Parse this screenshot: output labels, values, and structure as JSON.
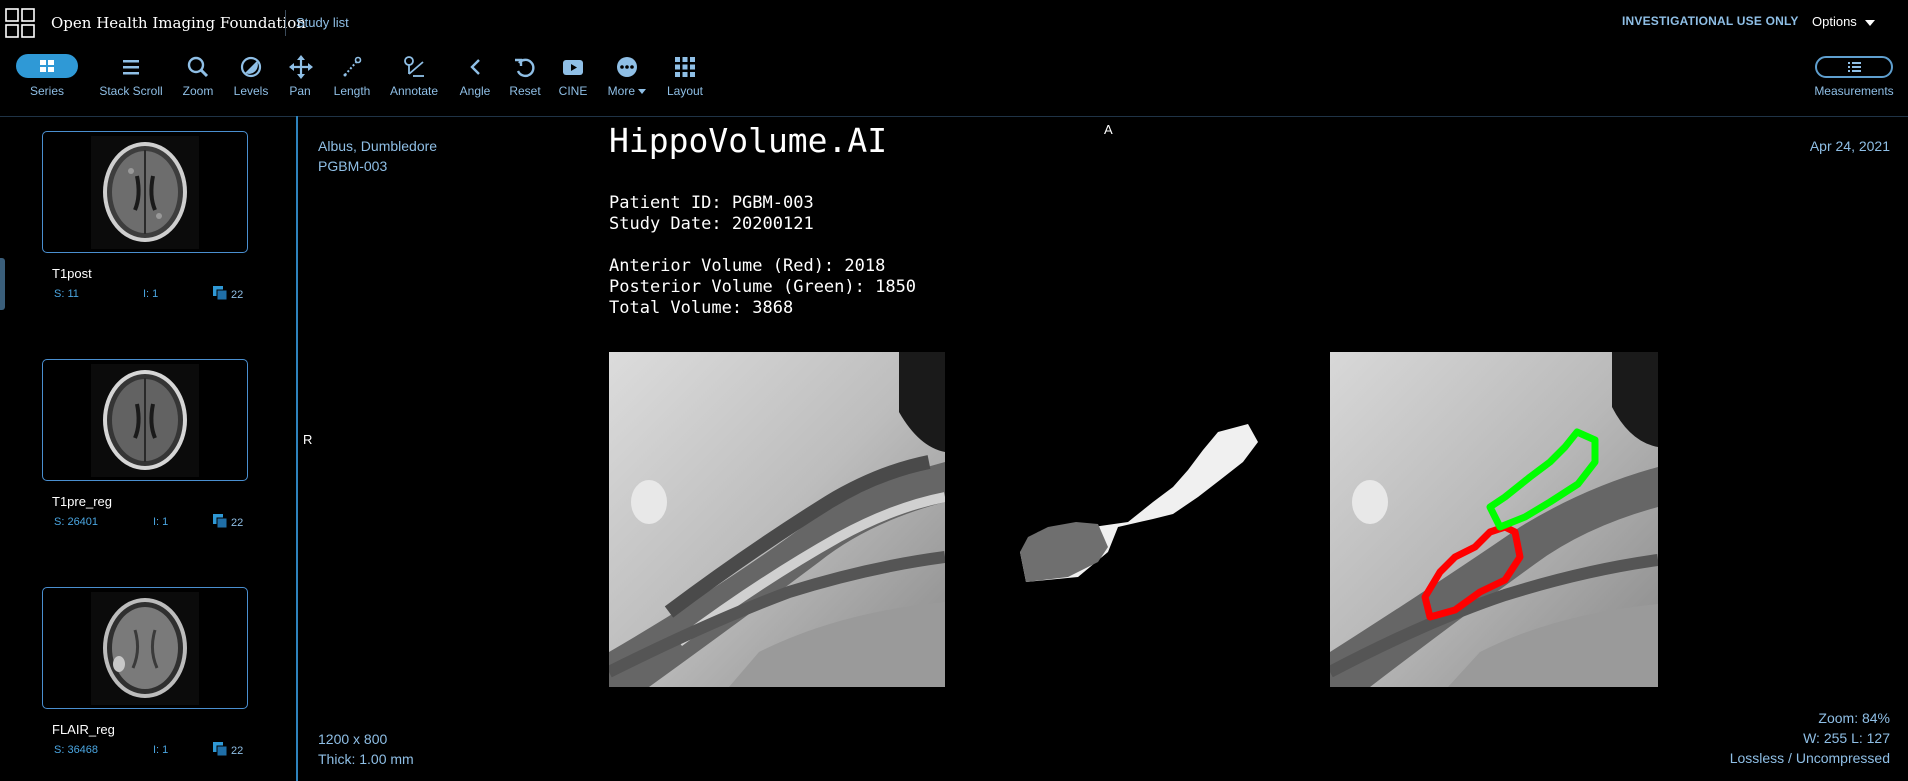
{
  "header": {
    "app_title": "Open Health Imaging Foundation",
    "study_list": "Study list",
    "investigational": "INVESTIGATIONAL USE ONLY",
    "options": "Options"
  },
  "toolbar": {
    "series": "Series",
    "stack_scroll": "Stack Scroll",
    "zoom": "Zoom",
    "levels": "Levels",
    "pan": "Pan",
    "length": "Length",
    "annotate": "Annotate",
    "angle": "Angle",
    "reset": "Reset",
    "cine": "CINE",
    "more": "More",
    "layout": "Layout",
    "measurements": "Measurements"
  },
  "series": [
    {
      "description": "T1post",
      "series_num": "S: 11",
      "instance": "I: 1",
      "count": "22"
    },
    {
      "description": "T1pre_reg",
      "series_num": "S: 26401",
      "instance": "I: 1",
      "count": "22"
    },
    {
      "description": "FLAIR_reg",
      "series_num": "S: 36468",
      "instance": "I: 1",
      "count": "22"
    }
  ],
  "viewport": {
    "patient_name": "Albus, Dumbledore",
    "patient_id": "PGBM-003",
    "study_date": "Apr 24, 2021",
    "orientation_top": "A",
    "orientation_left": "R",
    "dimensions": "1200 x 800",
    "thickness": "Thick: 1.00 mm",
    "zoom": "Zoom: 84%",
    "window_level": "W: 255 L: 127",
    "compression": "Lossless / Uncompressed"
  },
  "report": {
    "title": "HippoVolume.AI",
    "patient_id_line": "Patient ID: PGBM-003",
    "study_date_line": "Study Date: 20200121",
    "anterior_line": "Anterior Volume (Red): 2018",
    "posterior_line": "Posterior Volume (Green): 1850",
    "total_line": "Total Volume: 3868"
  },
  "colors": {
    "accent": "#2f99d6",
    "text_blue": "#8fbfe6",
    "anterior": "#ff0000",
    "posterior": "#00ff00"
  },
  "icons": [
    "grid-logo-icon",
    "series-icon",
    "stack-scroll-icon",
    "zoom-icon",
    "levels-icon",
    "pan-icon",
    "length-icon",
    "annotate-icon",
    "angle-icon",
    "reset-icon",
    "cine-icon",
    "more-icon",
    "layout-icon",
    "measurements-icon"
  ]
}
